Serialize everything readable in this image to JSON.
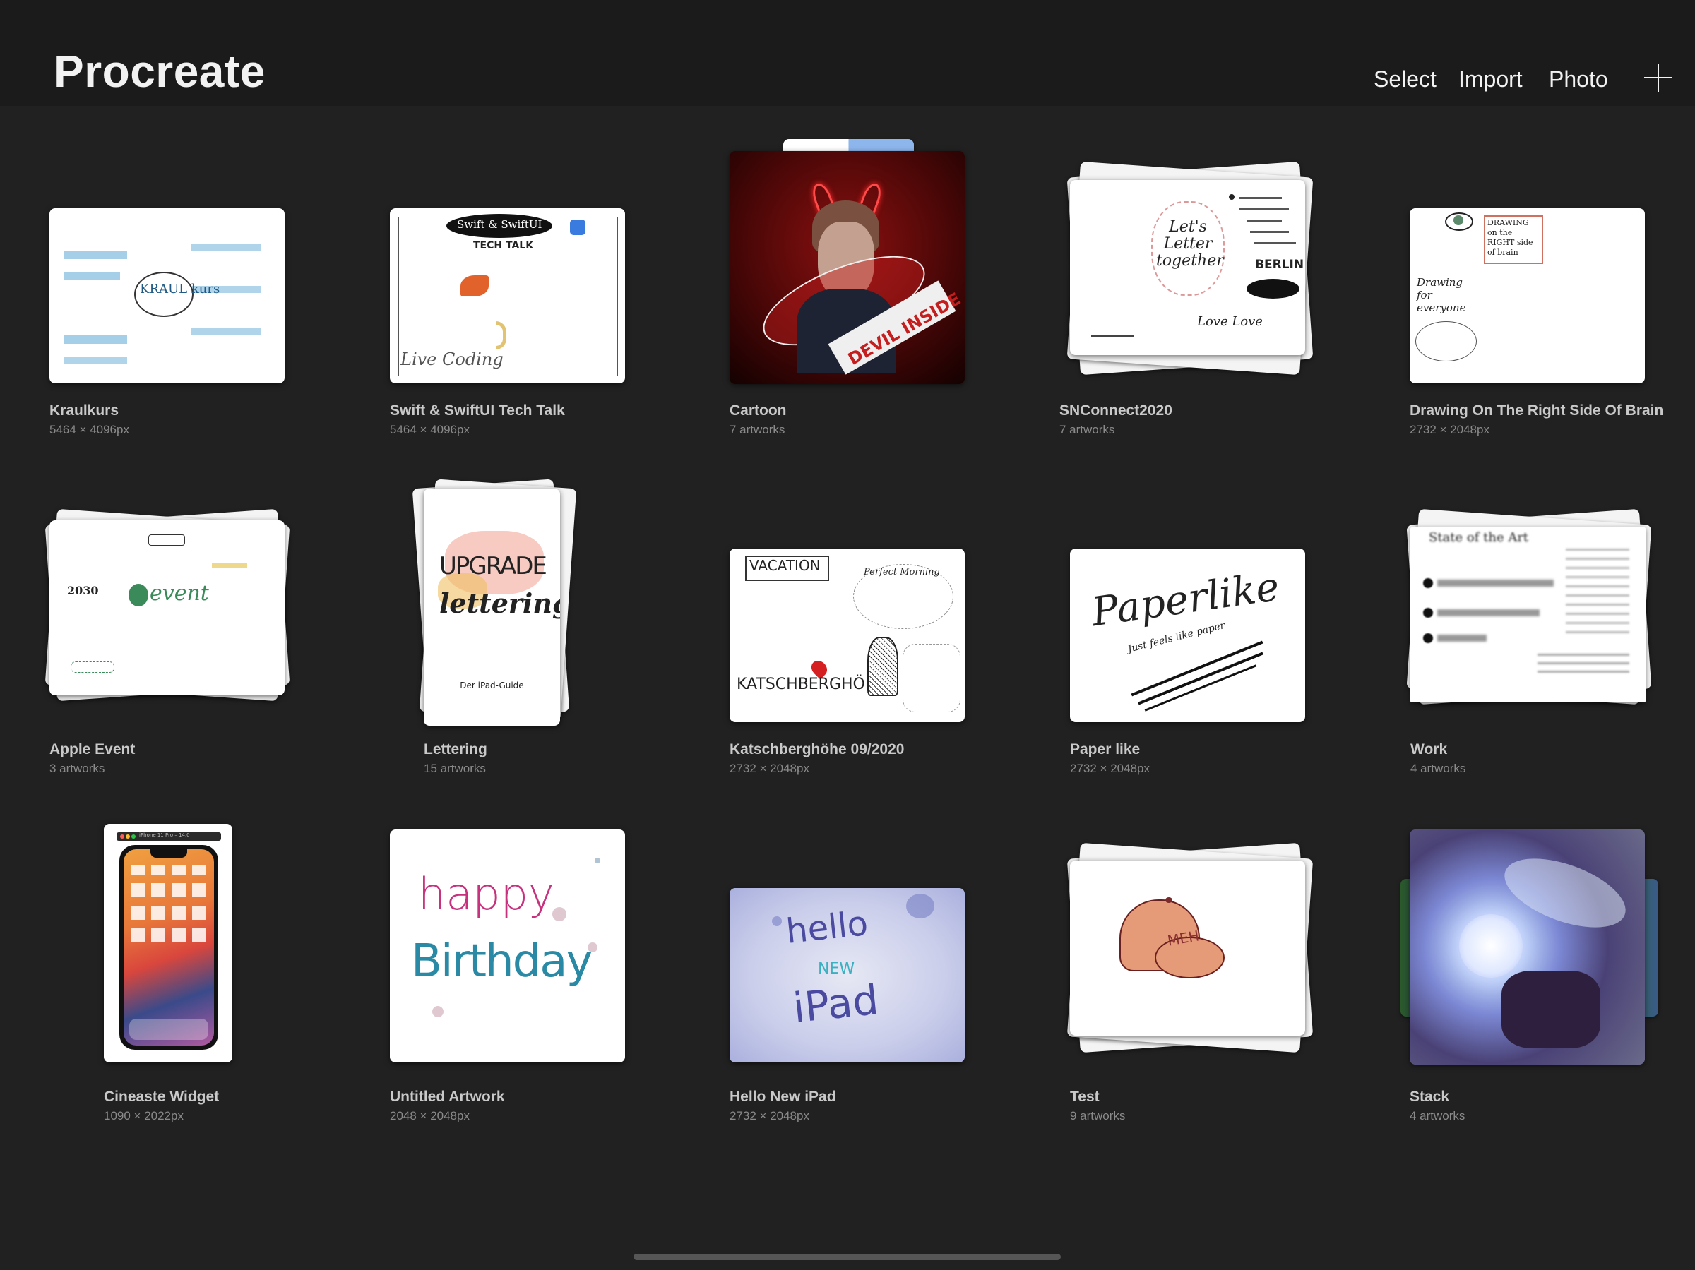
{
  "app": {
    "title": "Procreate"
  },
  "toolbar": {
    "select_label": "Select",
    "import_label": "Import",
    "photo_label": "Photo",
    "new_icon": "plus-icon"
  },
  "gallery": {
    "items": [
      {
        "title": "Kraulkurs",
        "subtitle": "5464 × 4096px",
        "kind": "artwork",
        "thumb_text": "KRAUL kurs"
      },
      {
        "title": "Swift & SwiftUI Tech Talk",
        "subtitle": "5464 × 4096px",
        "kind": "artwork",
        "thumb_text": "Swift & SwiftUI",
        "thumb_text2": "TECH TALK",
        "thumb_text3": "Live Coding"
      },
      {
        "title": "Cartoon",
        "subtitle": "7 artworks",
        "kind": "stack",
        "thumb_text": "DEVIL INSIDE"
      },
      {
        "title": "SNConnect2020",
        "subtitle": "7 artworks",
        "kind": "stack",
        "thumb_text": "Let's Letter together",
        "thumb_text2": "BERLIN",
        "thumb_text3": "Love Love"
      },
      {
        "title": "Drawing On The Right Side Of Brain",
        "subtitle": "2732 × 2048px",
        "kind": "artwork",
        "thumb_text": "DRAWING on the RIGHT side of brain",
        "thumb_text2": "Drawing for everyone"
      },
      {
        "title": "Apple Event",
        "subtitle": "3 artworks",
        "kind": "stack",
        "thumb_text": "event",
        "thumb_text2": "2030"
      },
      {
        "title": "Lettering",
        "subtitle": "15 artworks",
        "kind": "stack",
        "thumb_text": "UPGRADE",
        "thumb_text2": "lettering",
        "thumb_text3": "Der iPad-Guide"
      },
      {
        "title": "Katschberghöhe 09/2020",
        "subtitle": "2732 × 2048px",
        "kind": "artwork",
        "thumb_text": "VACATION",
        "thumb_text2": "KATSCHBERGHÖHE",
        "thumb_text3": "Perfect Morning"
      },
      {
        "title": "Paper like",
        "subtitle": "2732 × 2048px",
        "kind": "artwork",
        "thumb_text": "Paperlike",
        "thumb_text2": "Just feels like paper"
      },
      {
        "title": "Work",
        "subtitle": "4 artworks",
        "kind": "stack",
        "thumb_text": "State of the Art"
      },
      {
        "title": "Cineaste Widget",
        "subtitle": "1090 × 2022px",
        "kind": "artwork",
        "thumb_text": "iPhone 11 Pro – 14.0"
      },
      {
        "title": "Untitled Artwork",
        "subtitle": "2048 × 2048px",
        "kind": "artwork",
        "thumb_text": "happy",
        "thumb_text2": "Birthday"
      },
      {
        "title": "Hello New iPad",
        "subtitle": "2732 × 2048px",
        "kind": "artwork",
        "thumb_text": "hello",
        "thumb_text2": "NEW",
        "thumb_text3": "iPad"
      },
      {
        "title": "Test",
        "subtitle": "9 artworks",
        "kind": "stack",
        "thumb_text": "MEH"
      },
      {
        "title": "Stack",
        "subtitle": "4 artworks",
        "kind": "stack"
      }
    ]
  },
  "colors": {
    "background": "#212121",
    "topbar": "#1b1b1b",
    "title_text": "#f2f2f2",
    "item_title": "#c9c9c9",
    "item_subtitle": "#8a8a8a"
  }
}
